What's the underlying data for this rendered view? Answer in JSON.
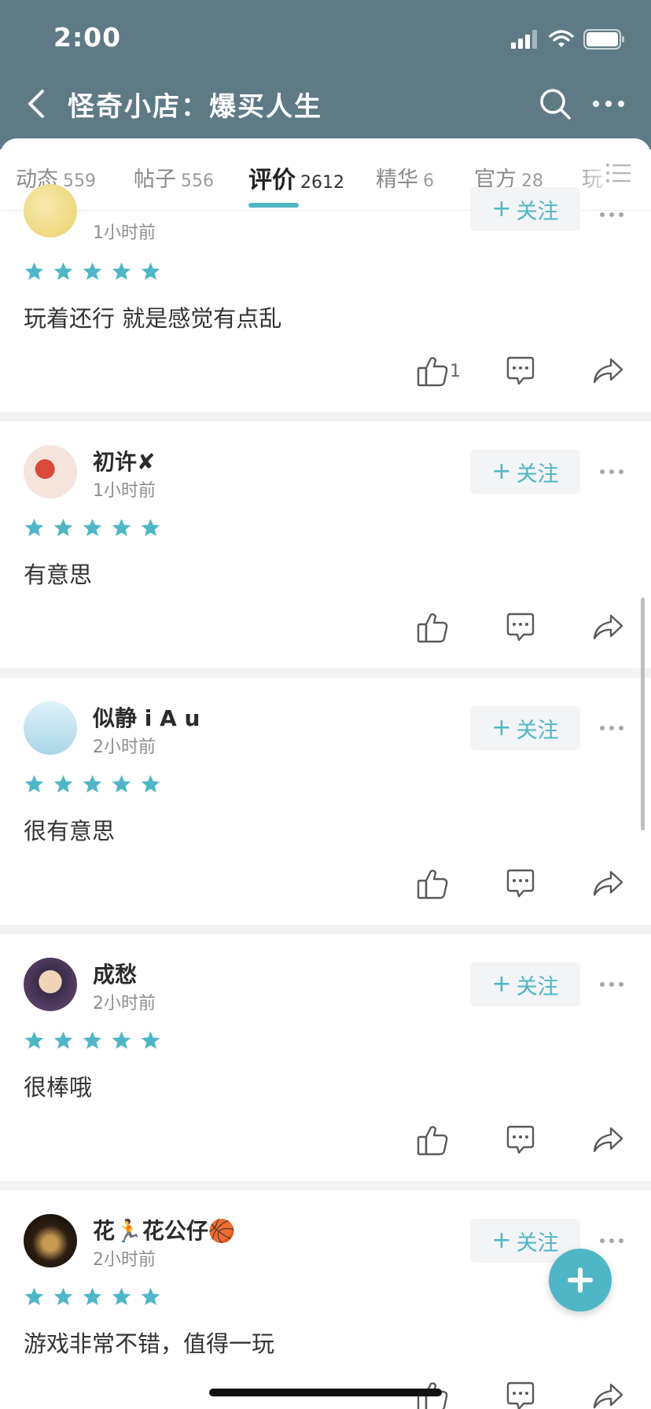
{
  "status_bar": {
    "time": "2:00"
  },
  "nav": {
    "title": "怪奇小店：爆买人生"
  },
  "tabs": [
    {
      "label": "动态",
      "count": "559"
    },
    {
      "label": "帖子",
      "count": "556"
    },
    {
      "label": "评价",
      "count": "2612",
      "active": true
    },
    {
      "label": "精华",
      "count": "6"
    },
    {
      "label": "官方",
      "count": "28"
    },
    {
      "label": "玩",
      "count": ""
    }
  ],
  "follow_label": "关注",
  "reviews": [
    {
      "user": "",
      "time": "1小时前",
      "stars": 5,
      "text": "玩着还行   就是感觉有点乱",
      "likes": "1"
    },
    {
      "user": "初许✘",
      "time": "1小时前",
      "stars": 5,
      "text": "有意思",
      "likes": ""
    },
    {
      "user": "似静 i A u",
      "time": "2小时前",
      "stars": 5,
      "text": "很有意思",
      "likes": ""
    },
    {
      "user": "成愁",
      "time": "2小时前",
      "stars": 5,
      "text": "很棒哦",
      "likes": ""
    },
    {
      "user": "花🏃花公仔🏀",
      "time": "2小时前",
      "stars": 5,
      "text": "游戏非常不错，值得一玩",
      "likes": ""
    }
  ],
  "colors": {
    "header": "#5e7a84",
    "accent": "#4fb6c6",
    "star": "#4fb6c6"
  },
  "icons": [
    "back-icon",
    "search-icon",
    "more-icon",
    "list-icon",
    "like-icon",
    "comment-icon",
    "share-icon",
    "plus-icon"
  ]
}
